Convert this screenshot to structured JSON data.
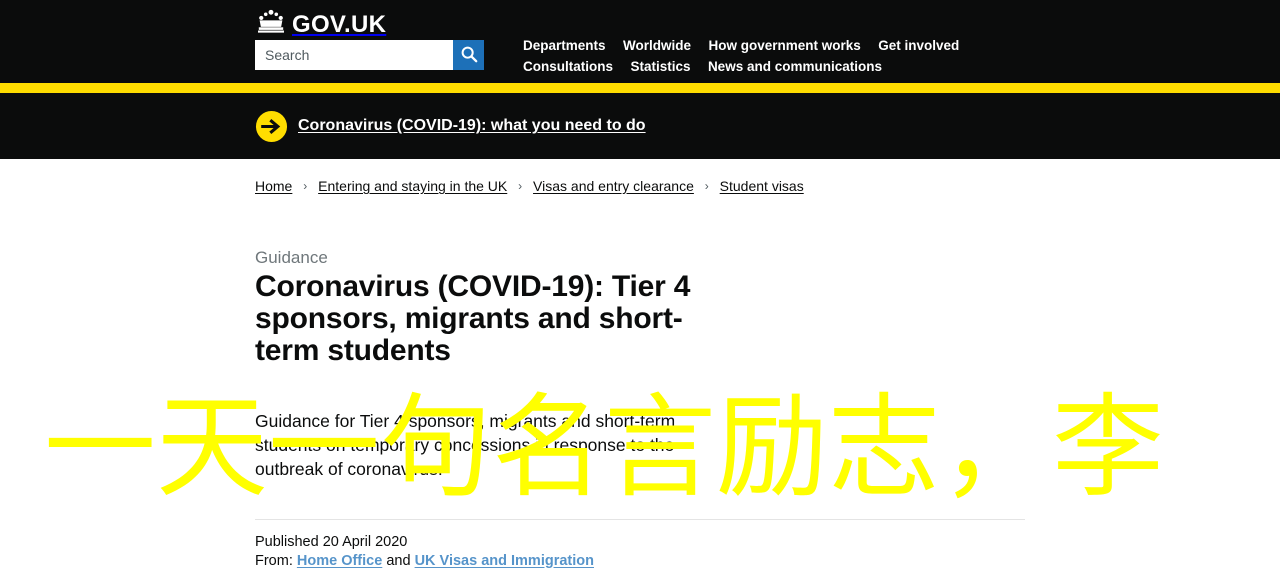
{
  "header": {
    "logo_text": "GOV.UK",
    "crown_icon": "crown-icon",
    "search": {
      "placeholder": "Search",
      "value": "",
      "icon": "search-icon"
    },
    "nav_row_1": [
      {
        "label": "Departments"
      },
      {
        "label": "Worldwide"
      },
      {
        "label": "How government works"
      },
      {
        "label": "Get involved"
      }
    ],
    "nav_row_2": [
      {
        "label": "Consultations"
      },
      {
        "label": "Statistics"
      },
      {
        "label": "News and communications"
      }
    ]
  },
  "banner": {
    "icon": "arrow-right-circle-icon",
    "link_label": "Coronavirus (COVID-19): what you need to do"
  },
  "breadcrumb": [
    {
      "label": "Home"
    },
    {
      "label": "Entering and staying in the UK"
    },
    {
      "label": "Visas and entry clearance"
    },
    {
      "label": "Student visas"
    }
  ],
  "breadcrumb_separator": "›",
  "article": {
    "kicker": "Guidance",
    "title": "Coronavirus (COVID-19): Tier 4 sponsors, migrants and short-term students",
    "summary": "Guidance for Tier 4 sponsors, migrants and short-term students on temporary concessions in response to the outbreak of coronavirus.",
    "published": "Published 20 April 2020",
    "from_prefix": "From:",
    "from_org_1": "Home Office",
    "from_conjunction": "and",
    "from_org_2": "UK Visas and Immigration"
  },
  "overlay": {
    "text": "一天一句名言励志，李"
  },
  "colors": {
    "black": "#0b0c0c",
    "govuk_yellow": "#ffdd00",
    "overlay_yellow": "#ffff00",
    "button_blue": "#1d70b8",
    "link_blue": "#5694ca",
    "grey_text": "#6f777b",
    "divider": "#e4e4e4"
  }
}
